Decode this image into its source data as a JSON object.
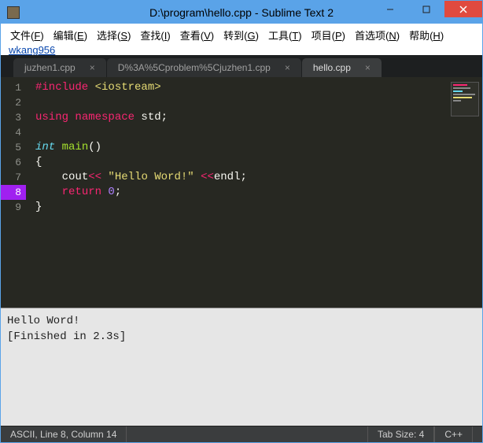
{
  "window": {
    "title": "D:\\program\\hello.cpp - Sublime Text 2"
  },
  "menu": {
    "file": {
      "label": "文件",
      "key": "F"
    },
    "edit": {
      "label": "编辑",
      "key": "E"
    },
    "select": {
      "label": "选择",
      "key": "S"
    },
    "find": {
      "label": "查找",
      "key": "I"
    },
    "view": {
      "label": "查看",
      "key": "V"
    },
    "goto": {
      "label": "转到",
      "key": "G"
    },
    "tools": {
      "label": "工具",
      "key": "T"
    },
    "project": {
      "label": "项目",
      "key": "P"
    },
    "prefs": {
      "label": "首选项",
      "key": "N"
    },
    "help": {
      "label": "帮助",
      "key": "H"
    },
    "crumb": "wkang956"
  },
  "tabs": [
    {
      "label": "juzhen1.cpp",
      "active": false
    },
    {
      "label": "D%3A%5Cproblem%5Cjuzhen1.cpp",
      "active": false
    },
    {
      "label": "hello.cpp",
      "active": true
    }
  ],
  "code": {
    "line1_pre": "#include",
    "line1_inc": " <iostream>",
    "line3_kw": "using",
    "line3_kw2": " namespace",
    "line3_name": " std",
    "line5_type": "int",
    "line5_fn": " main",
    "line7_name": "cout",
    "line7_op": "<<",
    "line7_str": " \"Hello Word!\" ",
    "line7_op2": "<<",
    "line7_name2": "endl",
    "line8_kw": "return",
    "line8_num": " 0",
    "semicolon": ";",
    "open_paren": "()",
    "brace_open": "{",
    "brace_close": "}"
  },
  "output": {
    "line1": "Hello Word!",
    "line2": "[Finished in 2.3s]"
  },
  "status": {
    "left": "ASCII, Line 8, Column 14",
    "tabsize": "Tab Size: 4",
    "lang": "C++"
  }
}
